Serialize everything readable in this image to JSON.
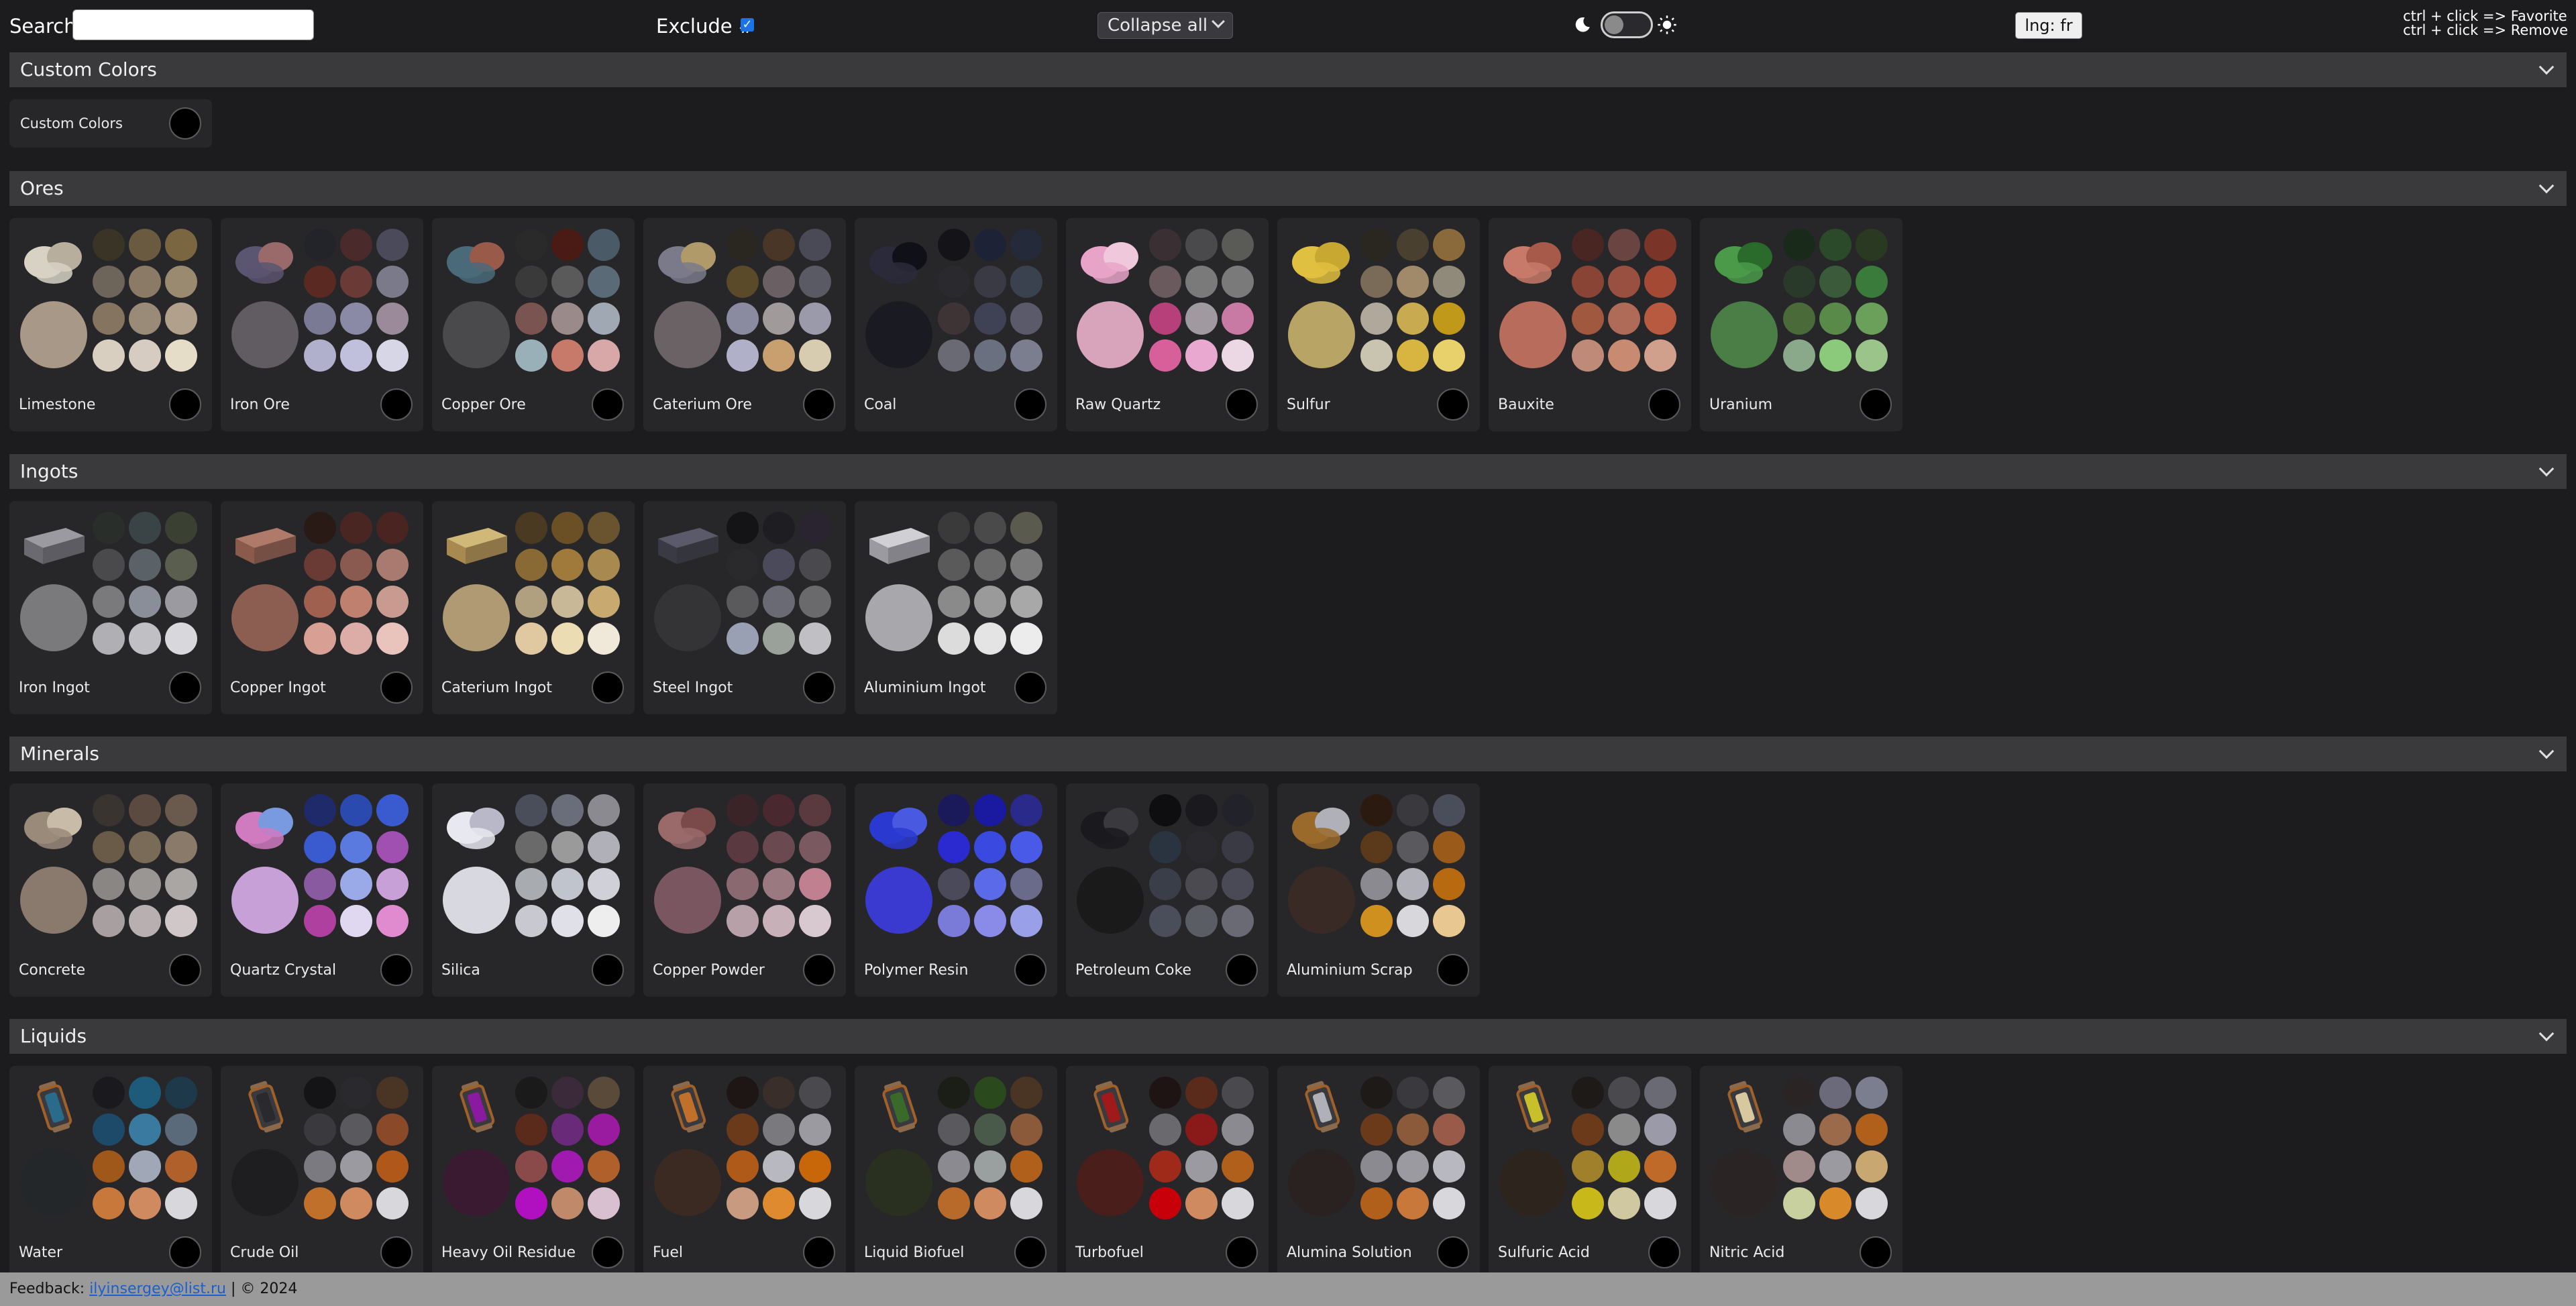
{
  "toolbar": {
    "search_label": "Search:",
    "search_value": "",
    "exclude_label": "Exclude #",
    "exclude_checked": true,
    "collapse_label": "Collapse all",
    "language_label": "lng: fr",
    "hint_favorite": "ctrl + click => Favorite",
    "hint_remove": "ctrl + click => Remove"
  },
  "sections": [
    {
      "title": "Custom Colors",
      "custom_label": "Custom Colors",
      "items": []
    },
    {
      "title": "Ores",
      "items": [
        {
          "name": "Limestone",
          "icon": "limestone-icon",
          "main": "#a89888",
          "thumb": [
            "#d8d2c4",
            "#b8ae9e"
          ],
          "dots": [
            "#3a3426",
            "#6a5a40",
            "#7a6640",
            "#6e655a",
            "#8a7a66",
            "#9a8a70",
            "#857560",
            "#9a8a78",
            "#b0a08c",
            "#d8cfc0",
            "#d6ccc2",
            "#e6ddc8"
          ]
        },
        {
          "name": "Iron Ore",
          "icon": "iron-ore-icon",
          "main": "#615c62",
          "thumb": [
            "#5a5570",
            "#9a6a6a"
          ],
          "dots": [
            "#23232a",
            "#4a2a2a",
            "#4a4a5a",
            "#5a2a22",
            "#6a3a36",
            "#7a7a8a",
            "#7a7a94",
            "#8a8aa6",
            "#9a8a9a",
            "#b0b0cc",
            "#c0c0dc",
            "#d6d6e6"
          ]
        },
        {
          "name": "Copper Ore",
          "icon": "copper-ore-icon",
          "main": "#4a4a4c",
          "thumb": [
            "#4a6a7a",
            "#9a5a4a"
          ],
          "dots": [
            "#2a2a2a",
            "#4a1a14",
            "#4a5a66",
            "#3a3a3a",
            "#5a5a5a",
            "#5a6a76",
            "#7a5450",
            "#9a8a8a",
            "#a0a8b4",
            "#9ab0b8",
            "#c87a6a",
            "#d8a8a8"
          ]
        },
        {
          "name": "Caterium Ore",
          "icon": "caterium-ore-icon",
          "main": "#6a6264",
          "thumb": [
            "#7a7a8a",
            "#b09a6a"
          ],
          "dots": [
            "#2a2620",
            "#4a3626",
            "#4a4a56",
            "#5a4a2a",
            "#6a6064",
            "#5a5a64",
            "#8a8aa0",
            "#a09a9a",
            "#9a9aaa",
            "#b0b0c8",
            "#c8a070",
            "#d8ccb0"
          ]
        },
        {
          "name": "Coal",
          "icon": "coal-icon",
          "main": "#1a1a22",
          "thumb": [
            "#2a2a3a",
            "#101018"
          ],
          "dots": [
            "#141418",
            "#1e2236",
            "#242a3a",
            "#2a2a2e",
            "#3a3a44",
            "#3a4250",
            "#3e3436",
            "#3e4254",
            "#5a5a6a",
            "#6a6a74",
            "#6a7080",
            "#7a7e8e"
          ]
        },
        {
          "name": "Raw Quartz",
          "icon": "raw-quartz-icon",
          "main": "#d8a4bc",
          "thumb": [
            "#e8a4c8",
            "#f0c8dc"
          ],
          "dots": [
            "#3a3034",
            "#4a4a4c",
            "#5a5a56",
            "#6a5a5e",
            "#7a7a7a",
            "#7a7a7a",
            "#b8407a",
            "#a09aa0",
            "#c87aa4",
            "#d8609a",
            "#e8a8d0",
            "#ecd8e4"
          ]
        },
        {
          "name": "Sulfur",
          "icon": "sulfur-icon",
          "main": "#b8a464",
          "thumb": [
            "#e0c040",
            "#c8a830"
          ],
          "dots": [
            "#2a2620",
            "#4a4030",
            "#8a6a3a",
            "#7a6a58",
            "#a08a6a",
            "#908a7a",
            "#b0a89a",
            "#c8aa50",
            "#c0981a",
            "#c8c4b0",
            "#d8b440",
            "#e8d06a"
          ]
        },
        {
          "name": "Bauxite",
          "icon": "bauxite-icon",
          "main": "#b86c5c",
          "thumb": [
            "#c87a6a",
            "#a85a4a"
          ],
          "dots": [
            "#4a2622",
            "#6a4440",
            "#7a3428",
            "#8a4436",
            "#9a5040",
            "#a44a34",
            "#a0583e",
            "#b06a58",
            "#b85a40",
            "#c08a78",
            "#c88a70",
            "#d0a08c"
          ]
        },
        {
          "name": "Uranium",
          "icon": "uranium-icon",
          "main": "#4a7e46",
          "thumb": [
            "#4a9a4a",
            "#2a6a2a"
          ],
          "dots": [
            "#1a2a1a",
            "#2a4a2a",
            "#2a3a22",
            "#2a3a2a",
            "#3a5a3a",
            "#3a7a3a",
            "#4a6a3a",
            "#5a8a4a",
            "#6aa05a",
            "#8aa88a",
            "#8aca7a",
            "#9ac48a"
          ]
        }
      ]
    },
    {
      "title": "Ingots",
      "items": [
        {
          "name": "Iron Ingot",
          "icon": "iron-ingot-icon",
          "main": "#7a7a7c",
          "thumb": [
            "#9a9aa0",
            "#6a6a70"
          ],
          "dots": [
            "#2a2e2a",
            "#3a4446",
            "#3a4032",
            "#4a4a4c",
            "#5a6268",
            "#5a5e4e",
            "#7a7a7c",
            "#8a8e98",
            "#9a9aa0",
            "#b0b0b4",
            "#c0c0c4",
            "#d8d8dc"
          ]
        },
        {
          "name": "Copper Ingot",
          "icon": "copper-ingot-icon",
          "main": "#8c5e52",
          "thumb": [
            "#b07a6a",
            "#8a5a4a"
          ],
          "dots": [
            "#2a1a16",
            "#4a2622",
            "#4a2420",
            "#6a3a34",
            "#8a5a50",
            "#a87a70",
            "#a06050",
            "#c08070",
            "#c89a90",
            "#d8a094",
            "#dcaca6",
            "#e8c4bc"
          ]
        },
        {
          "name": "Caterium Ingot",
          "icon": "caterium-ingot-icon",
          "main": "#b09a74",
          "thumb": [
            "#d0b878",
            "#a88a50"
          ],
          "dots": [
            "#4a3a22",
            "#6a5024",
            "#6a5430",
            "#8a6a34",
            "#a07a3a",
            "#a88a50",
            "#b0a080",
            "#c8b898",
            "#c8aa70",
            "#e0c8a0",
            "#ecdcb4",
            "#f0e8d8"
          ]
        },
        {
          "name": "Steel Ingot",
          "icon": "steel-ingot-icon",
          "main": "#343436",
          "thumb": [
            "#5a5a6a",
            "#3a3a44"
          ],
          "dots": [
            "#141416",
            "#1e1e22",
            "#2a2430",
            "#2a2a2c",
            "#4a4a5a",
            "#4a4a4e",
            "#5a5a5c",
            "#6a6a74",
            "#6a6a6c",
            "#9aa0b4",
            "#9aa09a",
            "#c0c0c4"
          ]
        },
        {
          "name": "Aluminium Ingot",
          "icon": "aluminium-ingot-icon",
          "main": "#a8a8ac",
          "thumb": [
            "#d0d0d4",
            "#9a9aa0"
          ],
          "dots": [
            "#3a3a3a",
            "#4a4a4a",
            "#5a5a4e",
            "#5a5a5a",
            "#6a6a6a",
            "#7a7a7a",
            "#8a8a8a",
            "#9a9a9a",
            "#a8a8a8",
            "#dcdcdc",
            "#e4e4e4",
            "#ececec"
          ]
        }
      ]
    },
    {
      "title": "Minerals",
      "items": [
        {
          "name": "Concrete",
          "icon": "concrete-icon",
          "main": "#8a7a6e",
          "thumb": [
            "#9a8a7a",
            "#c8bca8"
          ],
          "dots": [
            "#3a3430",
            "#5a4a40",
            "#6a5a4e",
            "#6a5a48",
            "#7a6a58",
            "#8a7a6a",
            "#8a8684",
            "#9a9694",
            "#aaa6a4",
            "#a8a0a0",
            "#b8b0b0",
            "#d0c8c8"
          ]
        },
        {
          "name": "Quartz Crystal",
          "icon": "quartz-crystal-icon",
          "main": "#c8a0d8",
          "thumb": [
            "#d07ac0",
            "#7a9ae0"
          ],
          "dots": [
            "#1e2a6a",
            "#2a4ab0",
            "#3a5ad0",
            "#3a5ad0",
            "#5a7ae0",
            "#a050b0",
            "#8a5aa0",
            "#9aaae8",
            "#c8a0d8",
            "#b040a0",
            "#e0d8f0",
            "#e08ad0"
          ]
        },
        {
          "name": "Silica",
          "icon": "silica-icon",
          "main": "#d8d8e0",
          "thumb": [
            "#e8e8f0",
            "#b8b8c8"
          ],
          "dots": [
            "#4a4e5a",
            "#6a6e7a",
            "#8a8a90",
            "#6a6a6a",
            "#9a9a9a",
            "#b0b0b8",
            "#a8acb0",
            "#c0c4cc",
            "#d0d0d8",
            "#c8c8d0",
            "#e0e0e8",
            "#eeeeee"
          ]
        },
        {
          "name": "Copper Powder",
          "icon": "copper-powder-icon",
          "main": "#7a5660",
          "thumb": [
            "#9a6a6a",
            "#7a4a4a"
          ],
          "dots": [
            "#3a2428",
            "#4a2830",
            "#5a3a3e",
            "#5a3a40",
            "#6a4a50",
            "#7a5a60",
            "#8a6a70",
            "#9a7a80",
            "#c08090",
            "#b8a0a8",
            "#c8b0b8",
            "#d8c8d0"
          ]
        },
        {
          "name": "Polymer Resin",
          "icon": "polymer-resin-icon",
          "main": "#3a3ad0",
          "thumb": [
            "#2a3ad0",
            "#4a5ae0"
          ],
          "dots": [
            "#1a1a5a",
            "#1a1aa0",
            "#2a2a8a",
            "#2a2ad0",
            "#3a4ae0",
            "#4a5ae8",
            "#4a4a5a",
            "#5a6ae8",
            "#6a6a8a",
            "#7a7ad8",
            "#8a8ae8",
            "#9aa0e8"
          ]
        },
        {
          "name": "Petroleum Coke",
          "icon": "petroleum-coke-icon",
          "main": "#1a1a1a",
          "thumb": [
            "#1a1a1e",
            "#3a3a3e"
          ],
          "dots": [
            "#0e0e10",
            "#1a1a1e",
            "#22222a",
            "#2a3440",
            "#2a2a2e",
            "#3a3a44",
            "#3a3e48",
            "#4a4a50",
            "#4a4a56",
            "#4a4e5a",
            "#5a5e64",
            "#6a6a74"
          ]
        },
        {
          "name": "Aluminium Scrap",
          "icon": "aluminium-scrap-icon",
          "main": "#3a2a26",
          "thumb": [
            "#9a6a2a",
            "#b0b0b8"
          ],
          "dots": [
            "#2a1a10",
            "#3a3a3e",
            "#4a4e5a",
            "#5a3a1a",
            "#5a5a5e",
            "#9a5a1a",
            "#8a8a90",
            "#b0b0b8",
            "#b86a10",
            "#d09020",
            "#d8d8dc",
            "#e8c890"
          ]
        }
      ]
    },
    {
      "title": "Liquids",
      "items": [
        {
          "name": "Water",
          "icon": "water-icon",
          "main": "#23272a",
          "thumb": [
            "#2a6a8a",
            "#a0602a"
          ],
          "dots": [
            "#1a1a1e",
            "#1e5a7a",
            "#1e3a4a",
            "#1e4a6a",
            "#3a7aa0",
            "#5a6a7a",
            "#a0581a",
            "#a0a8b8",
            "#b0602a",
            "#c8783a",
            "#d08a60",
            "#d8d8dc"
          ]
        },
        {
          "name": "Crude Oil",
          "icon": "crude-oil-icon",
          "main": "#1e1e20",
          "thumb": [
            "#2a2a2e",
            "#a0602a"
          ],
          "dots": [
            "#141416",
            "#2a2a2e",
            "#4a3424",
            "#3a3a3e",
            "#5a5a5e",
            "#8a4a2a",
            "#7a7a80",
            "#9a9aa0",
            "#b0581a",
            "#c0702a",
            "#d08a60",
            "#d8d8dc"
          ]
        },
        {
          "name": "Heavy Oil Residue",
          "icon": "heavy-oil-residue-icon",
          "main": "#3a1a30",
          "thumb": [
            "#8a1aa0",
            "#a0602a"
          ],
          "dots": [
            "#1a1a1a",
            "#3a2a3a",
            "#5a4a3a",
            "#5a2a1a",
            "#6a2a7a",
            "#9a1aa0",
            "#8a4a4a",
            "#a01ab0",
            "#b0602a",
            "#b010c0",
            "#c08a6a",
            "#d8c0d0"
          ]
        },
        {
          "name": "Fuel",
          "icon": "fuel-icon",
          "main": "#3a2a22",
          "thumb": [
            "#c0702a",
            "#a0602a"
          ],
          "dots": [
            "#1e1614",
            "#3a2e2a",
            "#4a4a4e",
            "#6a3a1a",
            "#7a7a7e",
            "#9a9aa0",
            "#b05a1a",
            "#b8b8c0",
            "#c8660a",
            "#c89a80",
            "#e08a30",
            "#d8d8dc"
          ]
        },
        {
          "name": "Liquid Biofuel",
          "icon": "liquid-biofuel-icon",
          "main": "#2a3020",
          "thumb": [
            "#3a6a2a",
            "#a0602a"
          ],
          "dots": [
            "#1a1e16",
            "#2a4a1e",
            "#4a3424",
            "#5a5a5e",
            "#4a5a4a",
            "#8a5a3a",
            "#8a8a90",
            "#9aa0a0",
            "#b0601a",
            "#b86a2a",
            "#d08a60",
            "#d8d8dc"
          ]
        },
        {
          "name": "Turbofuel",
          "icon": "turbofuel-icon",
          "main": "#4a1e1a",
          "thumb": [
            "#a01a1a",
            "#a0602a"
          ],
          "dots": [
            "#1e1414",
            "#5a2a1a",
            "#4a4a4e",
            "#6a6a6e",
            "#8a1a1a",
            "#8a8a90",
            "#a02a1a",
            "#9a9aa0",
            "#b0601a",
            "#c8000a",
            "#d08a60",
            "#d8d8dc"
          ]
        },
        {
          "name": "Alumina Solution",
          "icon": "alumina-solution-icon",
          "main": "#2a2220",
          "thumb": [
            "#b0b0b8",
            "#a0602a"
          ],
          "dots": [
            "#1e1a18",
            "#3a3a3e",
            "#5a5a5e",
            "#6a3a1a",
            "#8a5a3a",
            "#9a5a4a",
            "#8a8a90",
            "#9a9aa0",
            "#b8b8c0",
            "#b0601a",
            "#c8783a",
            "#d8d8dc"
          ]
        },
        {
          "name": "Sulfuric Acid",
          "icon": "sulfuric-acid-icon",
          "main": "#2e241e",
          "thumb": [
            "#c8c02a",
            "#a0602a"
          ],
          "dots": [
            "#1e1a18",
            "#4a4a4e",
            "#6a6a74",
            "#6a3a1a",
            "#8a8a8a",
            "#9a9aa8",
            "#a0802a",
            "#b0a81a",
            "#c06a2a",
            "#c8b81a",
            "#d0c8a0",
            "#d8d8dc"
          ]
        },
        {
          "name": "Nitric Acid",
          "icon": "nitric-acid-icon",
          "main": "#2a2424",
          "thumb": [
            "#d8c8a0",
            "#a0602a"
          ],
          "dots": [
            "#2a2424",
            "#6a6a7a",
            "#7a7e8e",
            "#8a8a90",
            "#9a6a4a",
            "#b0601a",
            "#a08a8a",
            "#9a9aa0",
            "#c8a870",
            "#c8d0a0",
            "#d88a2a",
            "#d8d8dc"
          ]
        }
      ]
    }
  ],
  "footer": {
    "prefix": "Feedback:",
    "link": "ilyinsergey@list.ru",
    "suffix": "| © 2024"
  }
}
